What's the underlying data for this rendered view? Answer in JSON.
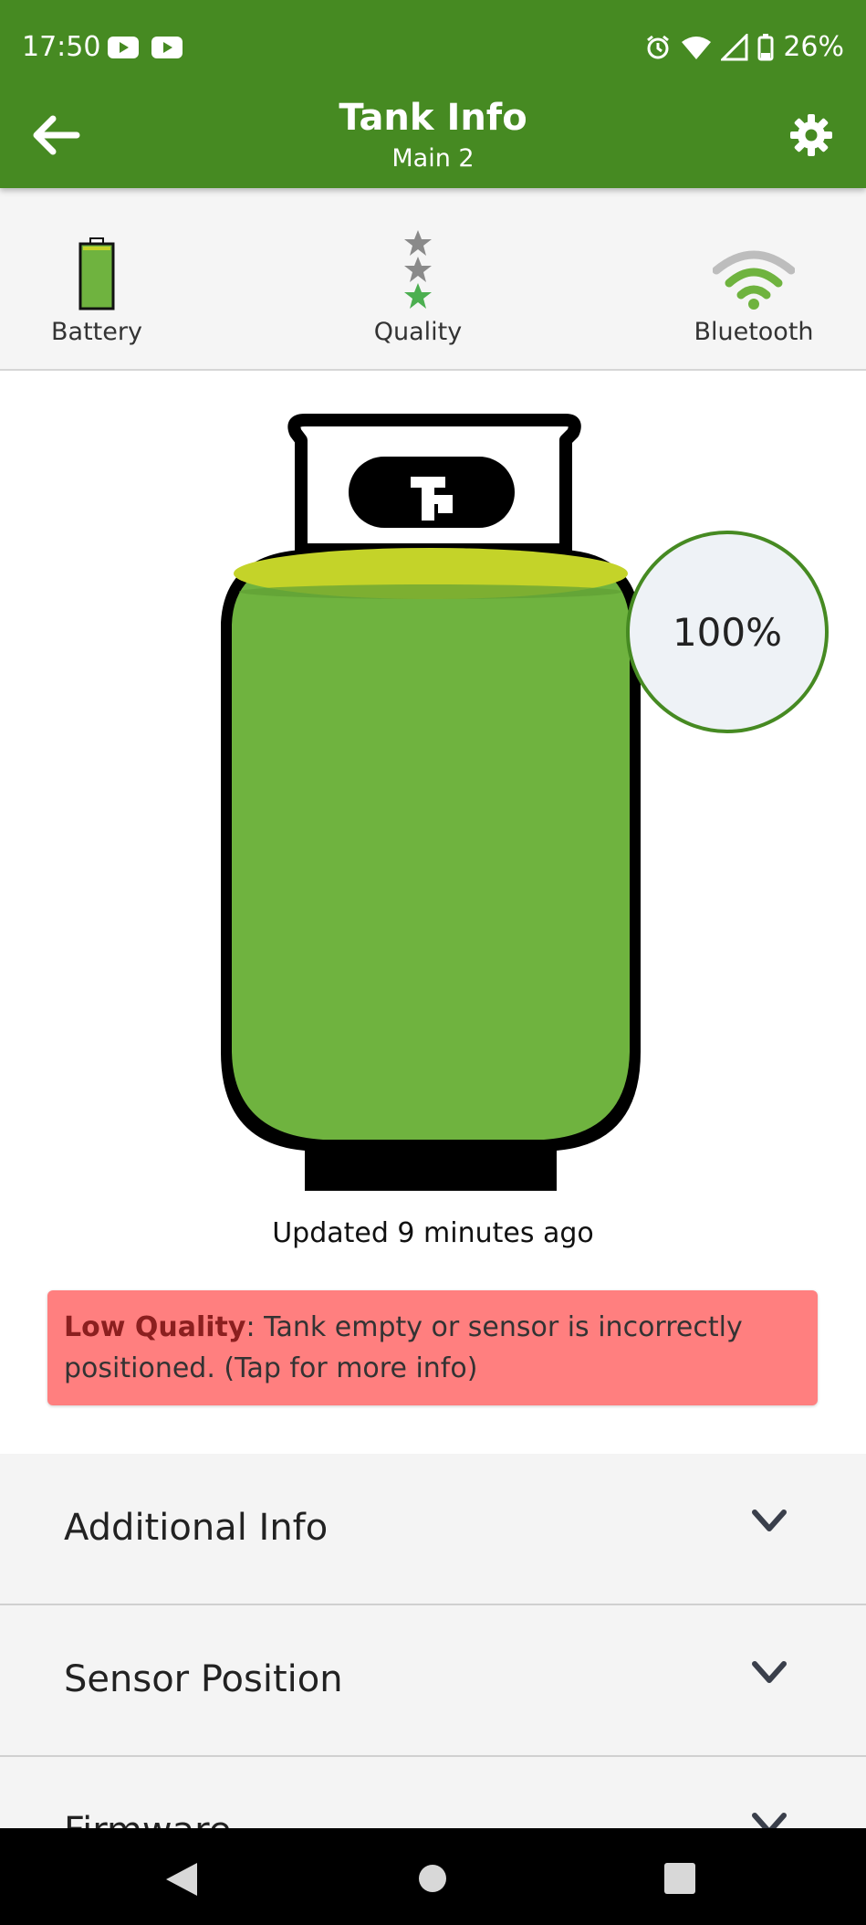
{
  "status_bar": {
    "time": "17:50",
    "battery_percent": "26%"
  },
  "header": {
    "title": "Tank Info",
    "subtitle": "Main 2"
  },
  "metrics": [
    {
      "label": "Battery",
      "icon": "battery-icon"
    },
    {
      "label": "Quality",
      "icon": "star-rating-icon"
    },
    {
      "label": "Bluetooth",
      "icon": "wifi-signal-icon"
    }
  ],
  "tank": {
    "fill_percent": 100,
    "percent_label": "100%",
    "updated_text": "Updated 9 minutes ago"
  },
  "alert": {
    "title": "Low Quality",
    "message": ": Tank empty or sensor is incorrectly positioned. (Tap for more info)"
  },
  "accordion": [
    {
      "label": "Additional Info"
    },
    {
      "label": "Sensor Position"
    },
    {
      "label": "Firmware"
    }
  ],
  "colors": {
    "header": "#468a22",
    "tank_fill": "#6fb33f",
    "tank_surface": "#c4d329",
    "alert": "#ff7f7f"
  }
}
